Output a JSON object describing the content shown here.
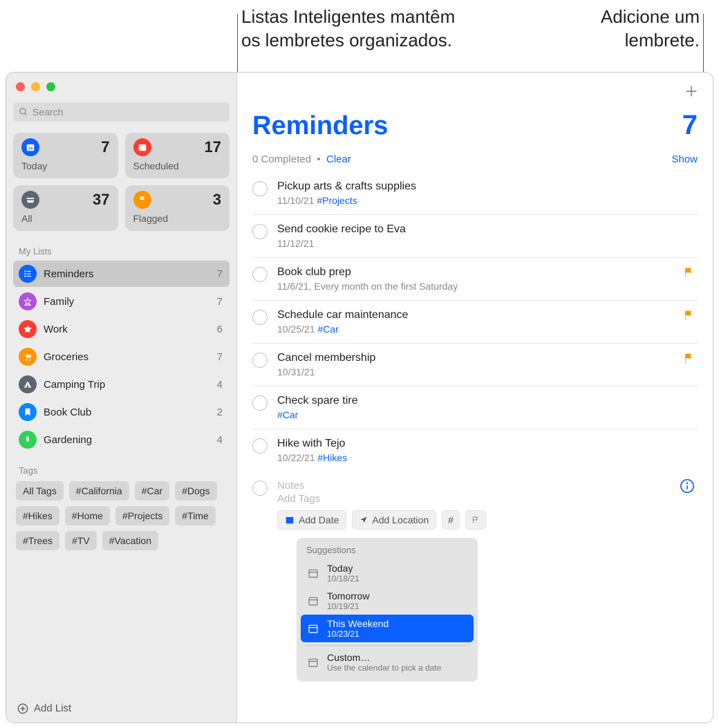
{
  "callouts": {
    "smartLists": "Listas Inteligentes mantêm\nos lembretes organizados.",
    "addReminder": "Adicione um\nlembrete."
  },
  "sidebar": {
    "searchPlaceholder": "Search",
    "smart": [
      {
        "label": "Today",
        "count": 7,
        "color": "#0a60ff"
      },
      {
        "label": "Scheduled",
        "count": 17,
        "color": "#ff3b30"
      },
      {
        "label": "All",
        "count": 37,
        "color": "#5b6770"
      },
      {
        "label": "Flagged",
        "count": 3,
        "color": "#ff9500"
      }
    ],
    "myListsLabel": "My Lists",
    "lists": [
      {
        "name": "Reminders",
        "count": 7,
        "color": "#0a60ff",
        "selected": true
      },
      {
        "name": "Family",
        "count": 7,
        "color": "#af52de"
      },
      {
        "name": "Work",
        "count": 6,
        "color": "#ff3b30"
      },
      {
        "name": "Groceries",
        "count": 7,
        "color": "#ff9500"
      },
      {
        "name": "Camping Trip",
        "count": 4,
        "color": "#5b6770"
      },
      {
        "name": "Book Club",
        "count": 2,
        "color": "#0a84ff"
      },
      {
        "name": "Gardening",
        "count": 4,
        "color": "#30d158"
      }
    ],
    "tagsLabel": "Tags",
    "tags": [
      "All Tags",
      "#California",
      "#Car",
      "#Dogs",
      "#Hikes",
      "#Home",
      "#Projects",
      "#Time",
      "#Trees",
      "#TV",
      "#Vacation"
    ],
    "addList": "Add List"
  },
  "main": {
    "title": "Reminders",
    "count": 7,
    "completedText": "0 Completed",
    "clear": "Clear",
    "show": "Show",
    "items": [
      {
        "title": "Pickup arts & crafts supplies",
        "date": "11/10/21",
        "tag": "#Projects",
        "flagged": false
      },
      {
        "title": "Send cookie recipe to Eva",
        "date": "11/12/21",
        "tag": "",
        "flagged": false
      },
      {
        "title": "Book club prep",
        "date": "11/6/21, Every month on the first Saturday",
        "tag": "",
        "flagged": true
      },
      {
        "title": "Schedule car maintenance",
        "date": "10/25/21",
        "tag": "#Car",
        "flagged": true
      },
      {
        "title": "Cancel membership",
        "date": "10/31/21",
        "tag": "",
        "flagged": true
      },
      {
        "title": "Check spare tire",
        "date": "",
        "tag": "#Car",
        "flagged": false
      },
      {
        "title": "Hike with Tejo",
        "date": "10/22/21",
        "tag": "#Hikes",
        "flagged": false
      }
    ],
    "newEntry": {
      "notes": "Notes",
      "addTags": "Add Tags",
      "addDate": "Add Date",
      "addLocation": "Add Location"
    },
    "suggestions": {
      "label": "Suggestions",
      "items": [
        {
          "title": "Today",
          "sub": "10/18/21",
          "selected": false
        },
        {
          "title": "Tomorrow",
          "sub": "10/19/21",
          "selected": false
        },
        {
          "title": "This Weekend",
          "sub": "10/23/21",
          "selected": true
        },
        {
          "title": "Custom…",
          "sub": "Use the calendar to pick a date",
          "selected": false,
          "divider": true
        }
      ]
    }
  }
}
